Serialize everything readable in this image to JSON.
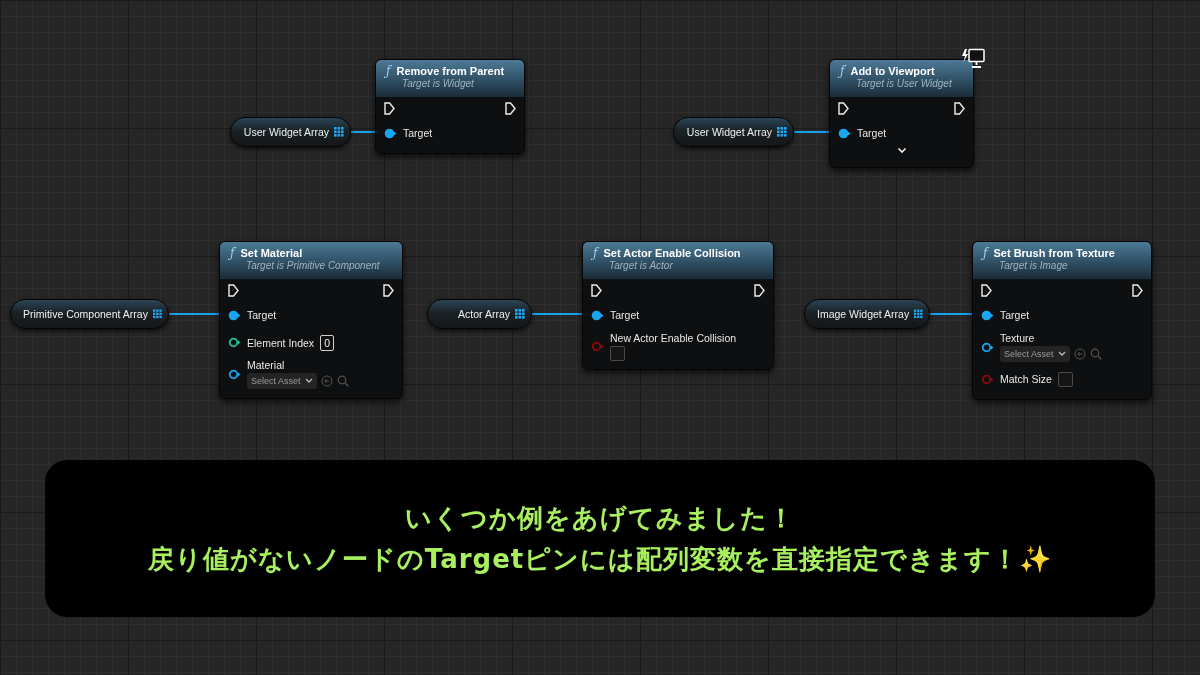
{
  "graph": {
    "groups": [
      {
        "variable": {
          "label": "User Widget Array"
        },
        "node": {
          "icon": "ƒ",
          "title": "Remove from Parent",
          "subtitle": "Target is Widget",
          "badge": false,
          "advanced": false,
          "pins": [
            {
              "kind": "object",
              "label": "Target",
              "connected": true
            }
          ]
        }
      },
      {
        "variable": {
          "label": "User Widget Array"
        },
        "node": {
          "icon": "ƒ",
          "title": "Add to Viewport",
          "subtitle": "Target is User Widget",
          "badge": true,
          "advanced": true,
          "pins": [
            {
              "kind": "object",
              "label": "Target",
              "connected": true
            }
          ]
        }
      },
      {
        "variable": {
          "label": "Primitive Component Array"
        },
        "node": {
          "icon": "ƒ",
          "title": "Set Material",
          "subtitle": "Target is Primitive Component",
          "badge": false,
          "advanced": false,
          "pins": [
            {
              "kind": "object",
              "label": "Target",
              "connected": true
            },
            {
              "kind": "int",
              "label": "Element Index",
              "value": "0"
            },
            {
              "kind": "asset",
              "label": "Material",
              "value": "Select Asset"
            }
          ]
        }
      },
      {
        "variable": {
          "label": "Actor Array"
        },
        "node": {
          "icon": "ƒ",
          "title": "Set Actor Enable Collision",
          "subtitle": "Target is Actor",
          "badge": false,
          "advanced": false,
          "pins": [
            {
              "kind": "object",
              "label": "Target",
              "connected": true
            },
            {
              "kind": "bool",
              "label": "New Actor Enable Collision",
              "stacked": true,
              "checked": false
            }
          ]
        }
      },
      {
        "variable": {
          "label": "Image Widget Array"
        },
        "node": {
          "icon": "ƒ",
          "title": "Set Brush from Texture",
          "subtitle": "Target is Image",
          "badge": false,
          "advanced": false,
          "pins": [
            {
              "kind": "object",
              "label": "Target",
              "connected": true
            },
            {
              "kind": "asset",
              "label": "Texture",
              "value": "Select Asset"
            },
            {
              "kind": "bool",
              "label": "Match Size",
              "stacked": false,
              "checked": false
            }
          ]
        }
      }
    ]
  },
  "caption": {
    "lines": [
      "いくつか例をあげてみました！",
      "戻り値がないノードのTargetピンには配列変数を直接指定できます！✨"
    ]
  }
}
